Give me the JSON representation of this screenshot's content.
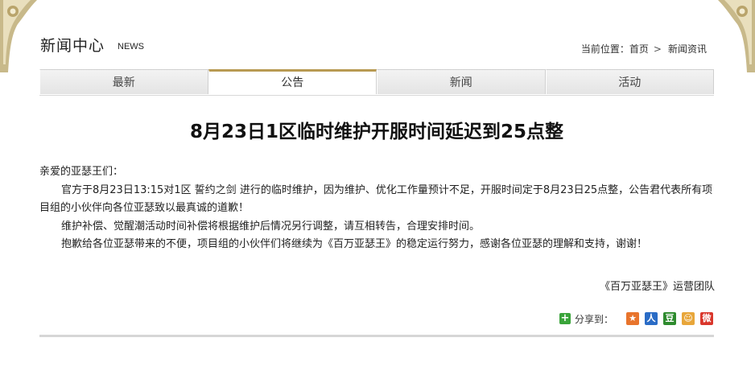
{
  "header": {
    "title": "新闻中心",
    "subtitle": "NEWS"
  },
  "breadcrumb": {
    "prefix": "当前位置：",
    "home": "首页",
    "separator": ">",
    "current": "新闻资讯"
  },
  "tabs": [
    {
      "label": "最新",
      "active": false
    },
    {
      "label": "公告",
      "active": true
    },
    {
      "label": "新闻",
      "active": false
    },
    {
      "label": "活动",
      "active": false
    }
  ],
  "article": {
    "title": "8月23日1区临时维护开服时间延迟到25点整",
    "greeting": "亲爱的亚瑟王们：",
    "paragraphs": [
      "官方于8月23日13:15对1区 誓约之剑 进行的临时维护，因为维护、优化工作量预计不足，开服时间定于8月23日25点整，公告君代表所有项目组的小伙伴向各位亚瑟致以最真诚的道歉！",
      "维护补偿、觉醒潮活动时间补偿将根据维护后情况另行调整，请互相转告，合理安排时间。",
      "抱歉给各位亚瑟带来的不便，项目组的小伙伴们将继续为《百万亚瑟王》的稳定运行努力，感谢各位亚瑟的理解和支持，谢谢！"
    ],
    "signature": "《百万亚瑟王》运营团队"
  },
  "share": {
    "label": "分享到：",
    "icons": [
      {
        "name": "qzone-share-icon",
        "color": "#e8742c",
        "glyph": "★"
      },
      {
        "name": "renren-share-icon",
        "color": "#2a6cc6",
        "glyph": "人"
      },
      {
        "name": "douban-share-icon",
        "color": "#2e8b2e",
        "glyph": "豆"
      },
      {
        "name": "kaixin-share-icon",
        "color": "#e8a63a",
        "glyph": "☺"
      },
      {
        "name": "weibo-share-icon",
        "color": "#d9362b",
        "glyph": "微"
      }
    ]
  },
  "colors": {
    "tab_active_border": "#b89a52",
    "text": "#222222"
  }
}
